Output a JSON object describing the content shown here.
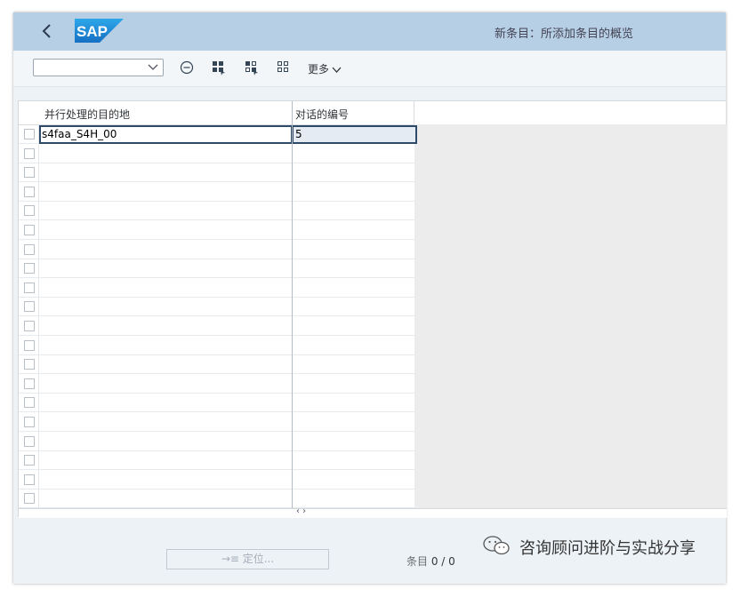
{
  "shell": {
    "title": "新条目：所添加条目的概览",
    "logo_text": "SAP",
    "brand_color": "#1f8ad6"
  },
  "toolbar": {
    "dropdown_value": "",
    "icons": [
      "remove-circle-icon",
      "select-all-icon",
      "select-block-icon",
      "deselect-all-icon"
    ],
    "more_label": "更多"
  },
  "table": {
    "columns": [
      "并行处理的目的地",
      "对话的编号"
    ],
    "rows": [
      {
        "destination": "s4faa_S4H_00",
        "dialog_count": "5"
      }
    ],
    "empty_row_count": 19
  },
  "footer": {
    "position_button_label": "→≡ 定位...",
    "entry_label": "条目",
    "entry_count": "0 / 0"
  },
  "watermark": {
    "text": "咨询顾问进阶与实战分享"
  }
}
